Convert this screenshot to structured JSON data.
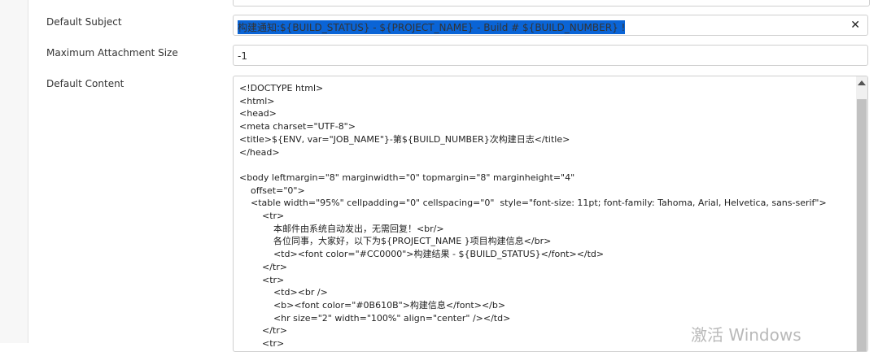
{
  "form": {
    "default_subject": {
      "label": "Default Subject",
      "value": "构建通知:${BUILD_STATUS} - ${PROJECT_NAME} - Build # ${BUILD_NUMBER} !"
    },
    "max_attachment": {
      "label": "Maximum Attachment Size",
      "value": "-1"
    },
    "default_content": {
      "label": "Default Content",
      "lines": [
        "<!DOCTYPE html>",
        "<html>",
        "<head>",
        "<meta charset=\"UTF-8\">",
        "<title>${ENV, var=\"JOB_NAME\"}-第${BUILD_NUMBER}次构建日志</title>",
        "</head>",
        "",
        "<body leftmargin=\"8\" marginwidth=\"0\" topmargin=\"8\" marginheight=\"4\"",
        "    offset=\"0\">",
        "    <table width=\"95%\" cellpadding=\"0\" cellspacing=\"0\"  style=\"font-size: 11pt; font-family: Tahoma, Arial, Helvetica, sans-serif\">",
        "        <tr>",
        "            本邮件由系统自动发出，无需回复！<br/>",
        "            各位同事，大家好，以下为${PROJECT_NAME }项目构建信息</br>",
        "            <td><font color=\"#CC0000\">构建结果 - ${BUILD_STATUS}</font></td>",
        "        </tr>",
        "        <tr>",
        "            <td><br />",
        "            <b><font color=\"#0B610B\">构建信息</font></b>",
        "            <hr size=\"2\" width=\"100%\" align=\"center\" /></td>",
        "        </tr>",
        "        <tr>"
      ]
    }
  },
  "watermark": "激活 Windows",
  "icons": {
    "clear": "close-icon",
    "scroll_up": "chevron-up-icon"
  },
  "colors": {
    "selection": "#0a64d6",
    "border": "#cfcfcf"
  }
}
